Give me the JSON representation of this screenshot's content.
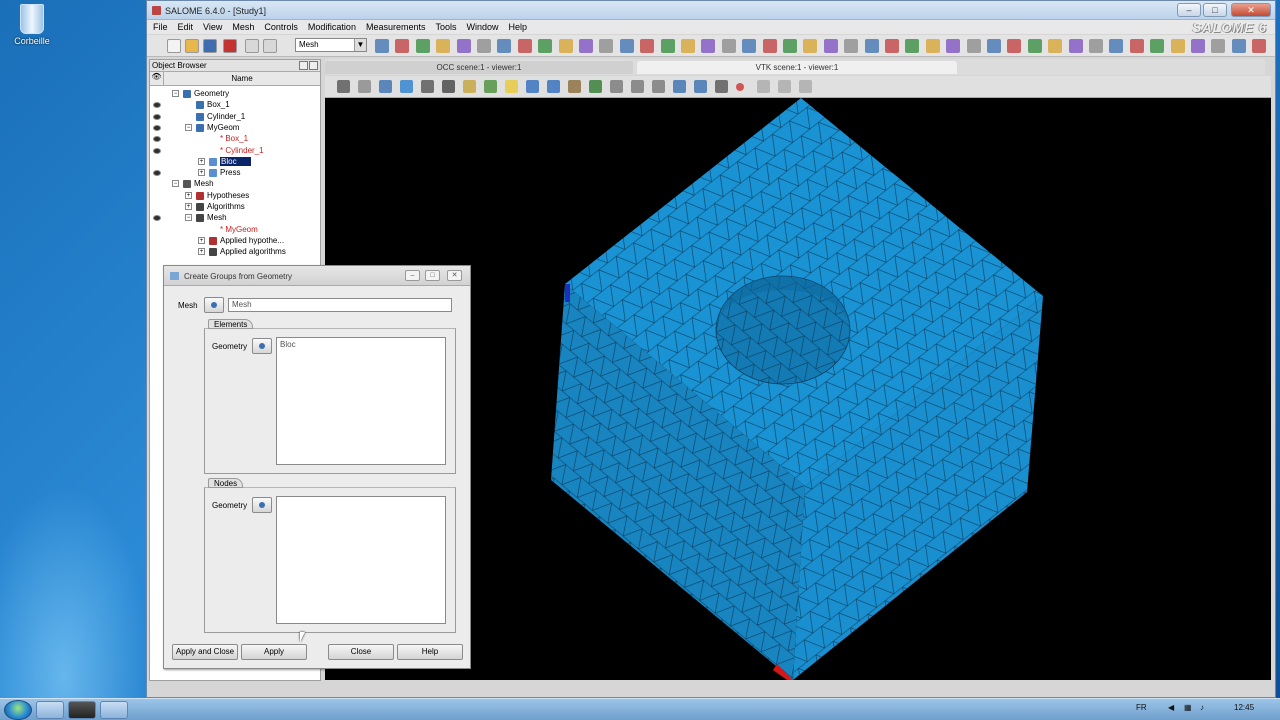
{
  "desktop": {
    "recycle_bin_label": "Corbeille"
  },
  "window": {
    "title": "SALOME 6.4.0 - [Study1]",
    "brand": "SALOME 6",
    "min": "–",
    "max": "□",
    "close": "✕"
  },
  "menu": [
    "File",
    "Edit",
    "View",
    "Mesh",
    "Controls",
    "Modification",
    "Measurements",
    "Tools",
    "Window",
    "Help"
  ],
  "toolbar": {
    "module_combo": "Mesh",
    "combo_arrow": "▼"
  },
  "object_browser": {
    "title": "Object Browser",
    "name_column": "Name",
    "eye_column": "👁",
    "items": [
      {
        "label": "Geometry",
        "indent": 0,
        "eye": false,
        "exp": "−",
        "color": "#000",
        "icon": "#3a6fb0"
      },
      {
        "label": "Box_1",
        "indent": 1,
        "eye": true,
        "exp": "",
        "color": "#000",
        "icon": "#3a6fb0"
      },
      {
        "label": "Cylinder_1",
        "indent": 1,
        "eye": true,
        "exp": "",
        "color": "#000",
        "icon": "#3a6fb0"
      },
      {
        "label": "MyGeom",
        "indent": 1,
        "eye": true,
        "exp": "−",
        "color": "#000",
        "icon": "#3a6fb0"
      },
      {
        "label": "* Box_1",
        "indent": 2,
        "eye": true,
        "exp": "",
        "color": "#c81e1e",
        "icon": ""
      },
      {
        "label": "* Cylinder_1",
        "indent": 2,
        "eye": true,
        "exp": "",
        "color": "#c81e1e",
        "icon": ""
      },
      {
        "label": "Bloc",
        "indent": 2,
        "eye": false,
        "exp": "+",
        "color": "#fff",
        "icon": "#5a8fd0",
        "selected": true
      },
      {
        "label": "Press",
        "indent": 2,
        "eye": true,
        "exp": "+",
        "color": "#000",
        "icon": "#5a8fd0"
      },
      {
        "label": "Mesh",
        "indent": 0,
        "eye": false,
        "exp": "−",
        "color": "#000",
        "icon": "#555"
      },
      {
        "label": "Hypotheses",
        "indent": 1,
        "eye": false,
        "exp": "+",
        "color": "#000",
        "icon": "#b03030"
      },
      {
        "label": "Algorithms",
        "indent": 1,
        "eye": false,
        "exp": "+",
        "color": "#000",
        "icon": "#444"
      },
      {
        "label": "Mesh",
        "indent": 1,
        "eye": true,
        "exp": "−",
        "color": "#000",
        "icon": "#444"
      },
      {
        "label": "* MyGeom",
        "indent": 2,
        "eye": false,
        "exp": "",
        "color": "#c81e1e",
        "icon": ""
      },
      {
        "label": "Applied hypothe...",
        "indent": 2,
        "eye": false,
        "exp": "+",
        "color": "#000",
        "icon": "#b03030"
      },
      {
        "label": "Applied algorithms",
        "indent": 2,
        "eye": false,
        "exp": "+",
        "color": "#000",
        "icon": "#444"
      }
    ]
  },
  "viewer_tabs": [
    "OCC scene:1 - viewer:1",
    "VTK scene:1 - viewer:1"
  ],
  "dialog": {
    "title": "Create Groups from Geometry",
    "mesh_label": "Mesh",
    "mesh_value": "Mesh",
    "elements_group": "Elements",
    "nodes_group": "Nodes",
    "geometry_label": "Geometry",
    "elements_list": [
      "Bloc"
    ],
    "buttons": {
      "apply_close": "Apply and Close",
      "apply": "Apply",
      "close": "Close",
      "help": "Help"
    }
  },
  "taskbar": {
    "lang": "FR",
    "time": "12:45"
  },
  "colors": {
    "mesh_face": "#1a8fd0",
    "mesh_edge": "#0b3b5a",
    "viewer_bg": "#000000",
    "selection": "#0a246a"
  }
}
